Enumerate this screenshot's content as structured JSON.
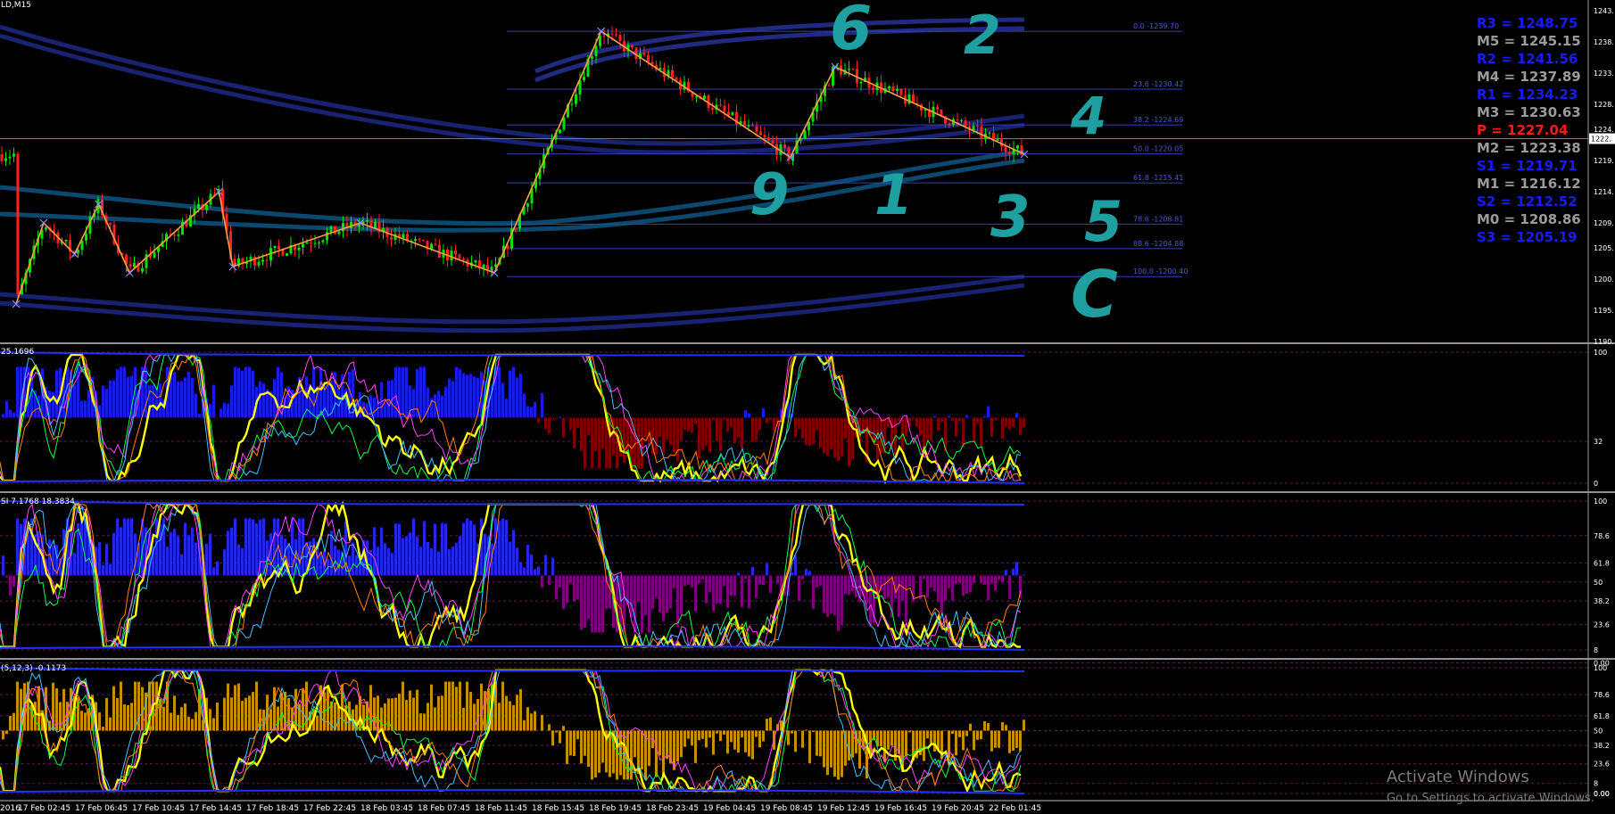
{
  "window": {
    "symbol_label": "LD,M15",
    "activate_title": "Activate Windows",
    "activate_sub": "Go to Settings to activate Windows."
  },
  "chart_data": [
    {
      "type": "candlestick",
      "panel": "price",
      "title": "LD,M15",
      "ylim": [
        1190,
        1244
      ],
      "y_ticks": [
        "1243.",
        "1238.",
        "1233.",
        "1228.",
        "1224.",
        "1219.",
        "1214.",
        "1209.",
        "1205.",
        "1200.",
        "1195.",
        "1190."
      ],
      "current_price_label": "1222.",
      "fib_levels": [
        {
          "label": "0.0 -1239.70",
          "value": 1239.7
        },
        {
          "label": "23.6 -1230.42",
          "value": 1230.42
        },
        {
          "label": "38.2 -1224.69",
          "value": 1224.69
        },
        {
          "label": "50.0 -1220.05",
          "value": 1220.05
        },
        {
          "label": "61.8 -1215.41",
          "value": 1215.41
        },
        {
          "label": "78.6 -1208.81",
          "value": 1208.81
        },
        {
          "label": "88.6 -1204.88",
          "value": 1204.88
        },
        {
          "label": "100.0 -1200.40",
          "value": 1200.4
        }
      ],
      "zigzag": [
        {
          "x": "17 Feb 00:45",
          "y": 1196
        },
        {
          "x": "17 Feb 02:45",
          "y": 1209
        },
        {
          "x": "17 Feb 05:00",
          "y": 1204
        },
        {
          "x": "17 Feb 06:45",
          "y": 1212
        },
        {
          "x": "17 Feb 09:00",
          "y": 1201
        },
        {
          "x": "17 Feb 15:30",
          "y": 1214
        },
        {
          "x": "17 Feb 16:30",
          "y": 1202
        },
        {
          "x": "18 Feb 01:45",
          "y": 1209
        },
        {
          "x": "18 Feb 11:30",
          "y": 1201
        },
        {
          "x": "18 Feb 19:15",
          "y": 1239.7
        },
        {
          "x": "19 Feb 09:00",
          "y": 1219.5
        },
        {
          "x": "19 Feb 12:15",
          "y": 1234
        },
        {
          "x": "22 Feb 02:00",
          "y": 1220
        }
      ],
      "pivots": [
        {
          "label": "R3 = 1248.75",
          "color": "#1a1aff"
        },
        {
          "label": "M5 = 1245.15",
          "color": "#9a9a9a"
        },
        {
          "label": "R2 = 1241.56",
          "color": "#1a1aff"
        },
        {
          "label": "M4 = 1237.89",
          "color": "#9a9a9a"
        },
        {
          "label": "R1 = 1234.23",
          "color": "#1a1aff"
        },
        {
          "label": "M3 = 1230.63",
          "color": "#9a9a9a"
        },
        {
          "label": "P  = 1227.04",
          "color": "#ff1a1a"
        },
        {
          "label": "M2 = 1223.38",
          "color": "#9a9a9a"
        },
        {
          "label": "S1 = 1219.71",
          "color": "#1a1aff"
        },
        {
          "label": "M1 = 1216.12",
          "color": "#9a9a9a"
        },
        {
          "label": "S2 = 1212.52",
          "color": "#1a1aff"
        },
        {
          "label": "M0 = 1208.86",
          "color": "#9a9a9a"
        },
        {
          "label": "S3 = 1205.19",
          "color": "#1a1aff"
        }
      ],
      "annotations": [
        "6",
        "2",
        "9",
        "1",
        "3",
        "4",
        "5",
        "C"
      ],
      "colors": {
        "up": "#00e000",
        "down": "#ff2020",
        "fib": "#3040c0",
        "zigzag": "#ffa040",
        "annotation": "#1fa0a0"
      }
    },
    {
      "type": "oscillator",
      "panel": "indicator-1",
      "header": "25.1696",
      "ylim": [
        0,
        100
      ],
      "y_ticks": [
        "100",
        "32",
        "0"
      ]
    },
    {
      "type": "oscillator",
      "panel": "indicator-2",
      "header": "SI 7.1768 18.3834",
      "ylim": [
        8,
        100
      ],
      "y_ticks": [
        "100",
        "78.6",
        "61.8",
        "50",
        "38.2",
        "23.6",
        "8",
        "0.00"
      ]
    },
    {
      "type": "oscillator",
      "panel": "indicator-3",
      "header": "(5,12,3) -0.1173",
      "ylim": [
        0,
        100
      ],
      "y_ticks": [
        "100",
        "78.6",
        "61.8",
        "50",
        "0.00",
        "38.2",
        "23.6",
        "8",
        "0.00"
      ]
    }
  ],
  "x_axis": {
    "labels": [
      "2016",
      "17 Feb 02:45",
      "17 Feb 06:45",
      "17 Feb 10:45",
      "17 Feb 14:45",
      "17 Feb 18:45",
      "17 Feb 22:45",
      "18 Feb 03:45",
      "18 Feb 07:45",
      "18 Feb 11:45",
      "18 Feb 15:45",
      "18 Feb 19:45",
      "18 Feb 23:45",
      "19 Feb 04:45",
      "19 Feb 08:45",
      "19 Feb 12:45",
      "19 Feb 16:45",
      "19 Feb 20:45",
      "22 Feb 01:45"
    ]
  }
}
